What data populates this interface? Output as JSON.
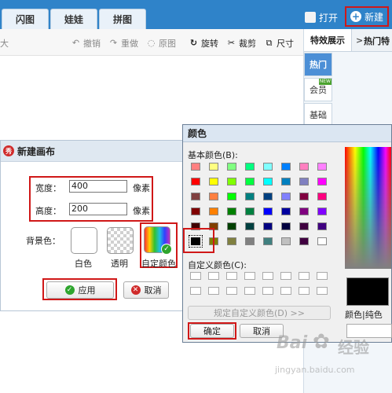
{
  "top_tabs": [
    "闪图",
    "娃娃",
    "拼图"
  ],
  "top_actions": {
    "open": "打开",
    "new": "新建"
  },
  "toolbar": {
    "left_fragment": "大",
    "undo": "撤销",
    "redo": "重做",
    "original": "原图",
    "rotate": "旋转",
    "crop": "裁剪",
    "size": "尺寸"
  },
  "right_panel": {
    "tab_effects": "特效展示",
    "tab_hot": "热门特",
    "tab_arrow": ">",
    "items": [
      "热门",
      "会员",
      "基础"
    ],
    "new_badge": "NEW"
  },
  "new_canvas_dialog": {
    "title": "新建画布",
    "logo": "秀",
    "width_label": "宽度：",
    "width_value": "400",
    "width_unit": "像素",
    "height_label": "高度：",
    "height_value": "200",
    "height_unit": "像素",
    "bg_label": "背景色：",
    "options": [
      "白色",
      "透明",
      "自定颜色"
    ],
    "apply": "应用",
    "cancel": "取消"
  },
  "color_dialog": {
    "title": "颜色",
    "basic_colors_label": "基本颜色(B):",
    "custom_colors_label": "自定义颜色(C):",
    "define_custom": "规定自定义颜色(D) >>",
    "ok": "确定",
    "cancel": "取消",
    "color_solid_label": "颜色|纯色",
    "basic_colors": [
      [
        "#ff8080",
        "#ffff80",
        "#80ff80",
        "#00ff80",
        "#80ffff",
        "#0080ff",
        "#ff80c0",
        "#ff80ff"
      ],
      [
        "#ff0000",
        "#ffff00",
        "#80ff00",
        "#00ff40",
        "#00ffff",
        "#0080c0",
        "#8080c0",
        "#ff00ff"
      ],
      [
        "#804040",
        "#ff8040",
        "#00ff00",
        "#008080",
        "#004080",
        "#8080ff",
        "#800040",
        "#ff0080"
      ],
      [
        "#800000",
        "#ff8000",
        "#008000",
        "#008040",
        "#0000ff",
        "#0000a0",
        "#800080",
        "#8000ff"
      ],
      [
        "#400000",
        "#804000",
        "#004000",
        "#004040",
        "#000080",
        "#000040",
        "#400040",
        "#400080"
      ],
      [
        "#000000",
        "#808000",
        "#808040",
        "#808080",
        "#408080",
        "#c0c0c0",
        "#400040",
        "#ffffff"
      ]
    ]
  },
  "watermark": {
    "brand": "Bai",
    "brand2": "经验",
    "url": "jingyan.baidu.com"
  }
}
